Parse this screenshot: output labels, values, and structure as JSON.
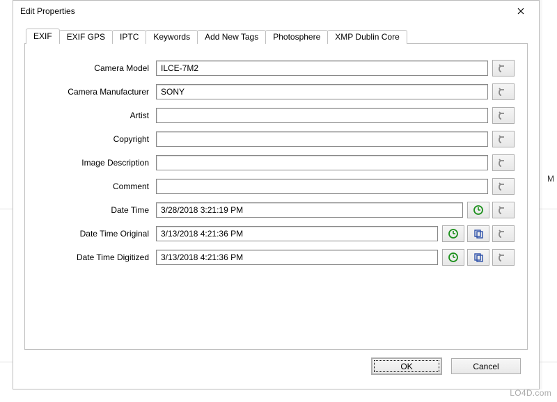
{
  "dialog": {
    "title": "Edit Properties"
  },
  "tabs": {
    "t0": "EXIF",
    "t1": "EXIF GPS",
    "t2": "IPTC",
    "t3": "Keywords",
    "t4": "Add New Tags",
    "t5": "Photosphere",
    "t6": "XMP Dublin Core"
  },
  "labels": {
    "camera_model": "Camera Model",
    "camera_manufacturer": "Camera Manufacturer",
    "artist": "Artist",
    "copyright": "Copyright",
    "image_description": "Image Description",
    "comment": "Comment",
    "date_time": "Date Time",
    "date_time_original": "Date Time Original",
    "date_time_digitized": "Date Time Digitized"
  },
  "values": {
    "camera_model": "ILCE-7M2",
    "camera_manufacturer": "SONY",
    "artist": "",
    "copyright": "",
    "image_description": "",
    "comment": "",
    "date_time": "3/28/2018 3:21:19 PM",
    "date_time_original": "3/13/2018 4:21:36 PM",
    "date_time_digitized": "3/13/2018 4:21:36 PM"
  },
  "buttons": {
    "ok": "OK",
    "cancel": "Cancel"
  },
  "watermark": "LO4D.com"
}
